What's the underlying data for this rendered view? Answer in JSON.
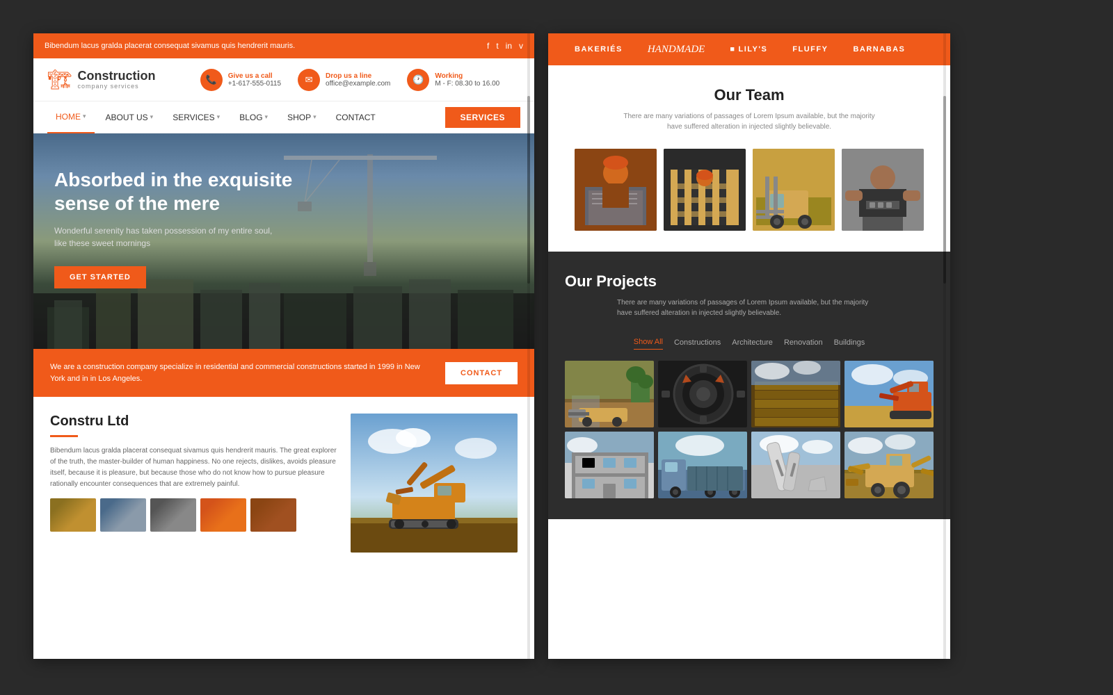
{
  "left": {
    "topbar": {
      "text": "Bibendum lacus gralda placerat consequat sivamus quis hendrerit mauris.",
      "icons": [
        "f",
        "t",
        "in",
        "v"
      ]
    },
    "header": {
      "logo_main": "Construction",
      "logo_sub": "company services",
      "contact1_label": "Give us a call",
      "contact1_value": "+1-617-555-0115",
      "contact2_label": "Drop us a line",
      "contact2_value": "office@example.com",
      "contact3_label": "Working",
      "contact3_value": "M - F: 08.30 to 16.00"
    },
    "nav": {
      "items": [
        "HOME",
        "ABOUT US",
        "SERVICES",
        "BLOG",
        "SHOP",
        "CONTACT"
      ],
      "active": "HOME",
      "cta": "SERVICES"
    },
    "hero": {
      "title": "Absorbed in the exquisite sense of the mere",
      "subtitle": "Wonderful serenity has taken possession of my entire soul, like these sweet mornings",
      "cta": "GET STARTED"
    },
    "infobar": {
      "text": "We are a construction company specialize in residential and commercial constructions  started in 1999 in New York and in in Los Angeles.",
      "cta": "CONTACT"
    },
    "about": {
      "title": "Constru Ltd",
      "body": "Bibendum lacus gralda placerat consequat sivamus quis hendrerit mauris. The great explorer of the truth, the master-builder of human happiness. No one rejects, dislikes, avoids pleasure itself, because it is pleasure, but because those who do not know how to pursue pleasure rationally encounter consequences that are extremely painful."
    }
  },
  "right": {
    "topnav": {
      "items": [
        {
          "label": "BAKERIÉS",
          "style": "normal"
        },
        {
          "label": "Handmade",
          "style": "italic"
        },
        {
          "label": "LILY'S",
          "style": "normal",
          "bullet": "■"
        },
        {
          "label": "FLUFFY",
          "style": "normal"
        },
        {
          "label": "BARNABAS",
          "style": "normal"
        }
      ]
    },
    "team": {
      "title": "Our Team",
      "subtitle": "There are many variations of passages of Lorem Ipsum available, but the majority have suffered alteration in injected slightly believable."
    },
    "projects": {
      "title": "Our Projects",
      "subtitle": "There are many variations of passages of Lorem Ipsum available, but the majority have suffered alteration in injected slightly believable.",
      "filters": [
        "Show All",
        "Constructions",
        "Architecture",
        "Renovation",
        "Buildings"
      ],
      "active_filter": "Show All"
    }
  }
}
